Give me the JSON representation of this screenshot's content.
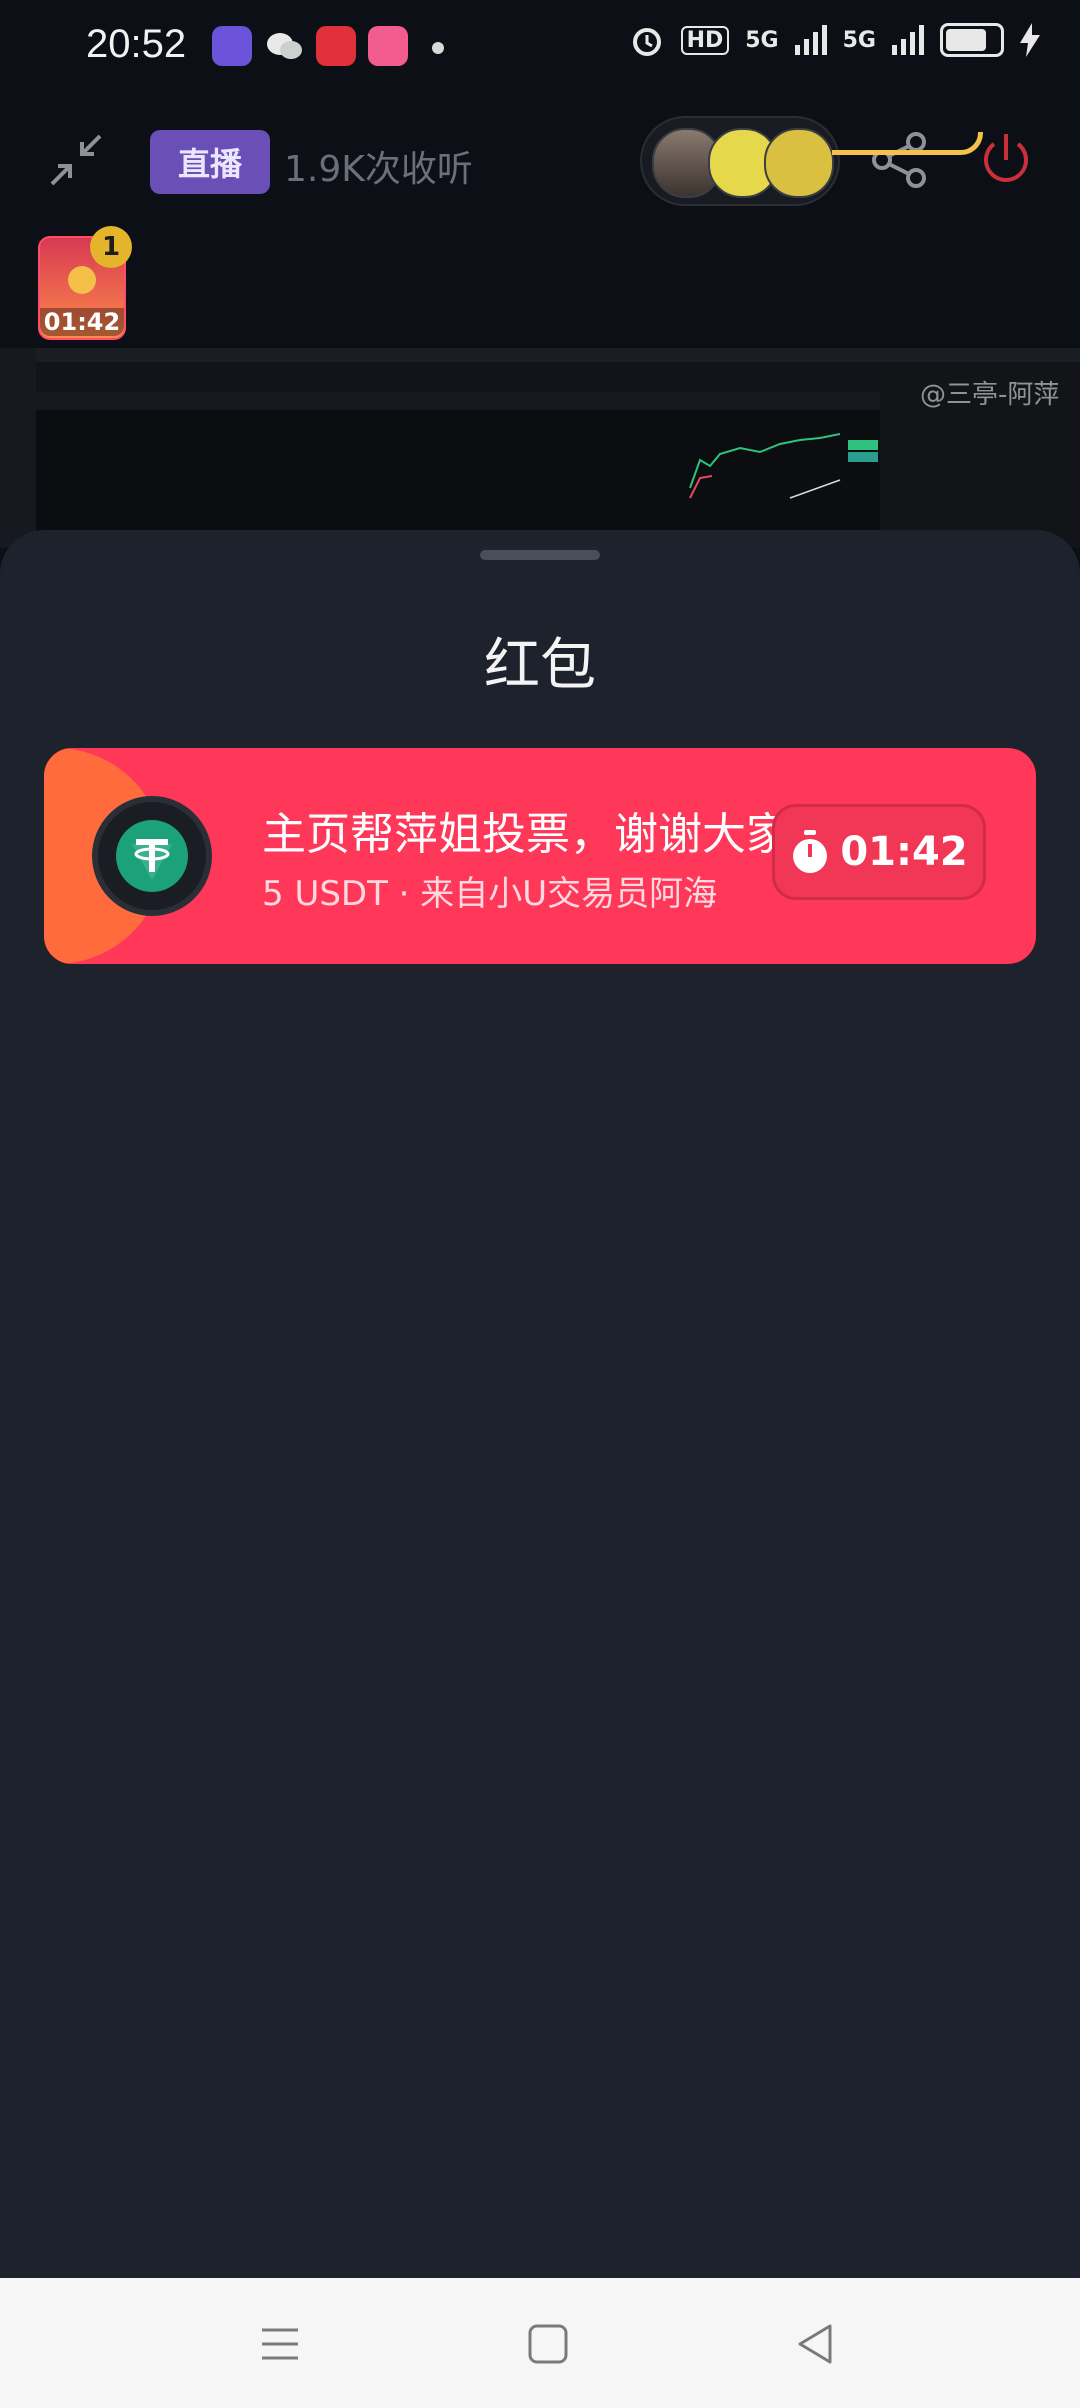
{
  "status_bar": {
    "time": "20:52",
    "hd_label": "HD",
    "network_1": "5G",
    "network_2": "5G"
  },
  "room": {
    "live_label": "直播",
    "listen_count": "1.9K次收听"
  },
  "floating_packet": {
    "badge_count": "1",
    "countdown": "01:42"
  },
  "video": {
    "watermark": "@三亭-阿萍"
  },
  "sheet": {
    "title": "红包"
  },
  "red_packet": {
    "message": "主页帮萍姐投票，谢谢大家",
    "detail": "5 USDT · 来自小U交易员阿海",
    "countdown": "01:42"
  },
  "colors": {
    "sheet_bg": "#1e222c",
    "card_red": "#ff3758",
    "card_orange": "#ff6b3d",
    "live_badge": "#6a4fb6",
    "power_red": "#d8303d",
    "usdt_green": "#1ba27a"
  },
  "icons": [
    "minimize-icon",
    "share-icon",
    "power-icon",
    "stopwatch-icon",
    "usdt-icon",
    "menu-icon",
    "home-icon",
    "back-icon"
  ]
}
